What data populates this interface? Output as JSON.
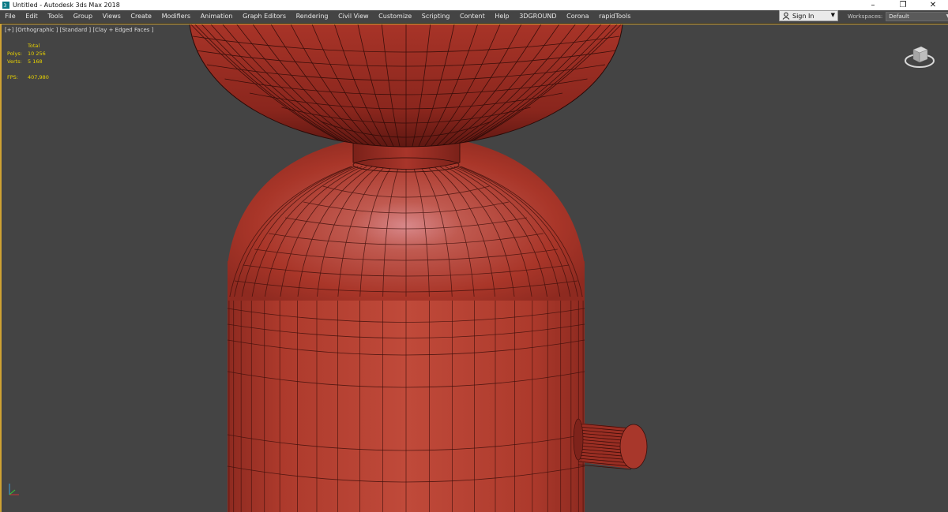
{
  "window": {
    "title": "Untitled - Autodesk 3ds Max 2018",
    "controls": [
      "–",
      "❐",
      "✕"
    ]
  },
  "menu": {
    "items": [
      "File",
      "Edit",
      "Tools",
      "Group",
      "Views",
      "Create",
      "Modifiers",
      "Animation",
      "Graph Editors",
      "Rendering",
      "Civil View",
      "Customize",
      "Scripting",
      "Content",
      "Help",
      "3DGROUND",
      "Corona",
      "rapidTools"
    ]
  },
  "signin": {
    "label": "Sign In"
  },
  "workspaces": {
    "label": "Workspaces:",
    "value": "Default"
  },
  "viewport": {
    "label": "[+] [Orthographic ] [Standard ] [Clay + Edged Faces ]",
    "stats": {
      "header": "Total",
      "polys_label": "Polys:",
      "polys_value": "10 256",
      "verts_label": "Verts:",
      "verts_value": "5 168",
      "fps_label": "FPS:",
      "fps_value": "407,980"
    }
  },
  "icons": {
    "app": "3dsmax-app-icon",
    "user": "user-icon",
    "viewcube": "viewcube-icon",
    "axis": "axis-tripod-icon"
  },
  "colors": {
    "viewport_bg": "#444444",
    "active_border": "#cfa233",
    "clay": "#b33a2e",
    "stats_text": "#e8d200"
  }
}
